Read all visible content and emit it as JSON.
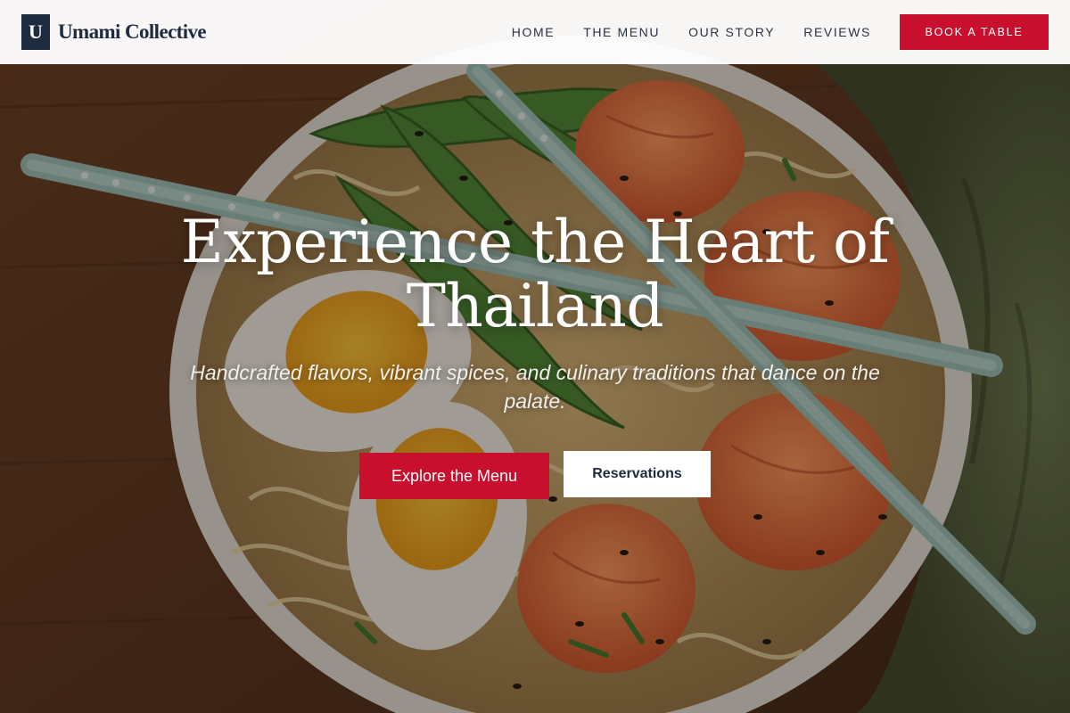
{
  "brand": {
    "mark": "U",
    "name": "Umami Collective"
  },
  "nav": {
    "items": [
      {
        "label": "HOME"
      },
      {
        "label": "THE MENU"
      },
      {
        "label": "OUR STORY"
      },
      {
        "label": "REVIEWS"
      }
    ],
    "cta_label": "BOOK A TABLE"
  },
  "hero": {
    "title": "Experience the Heart of Thailand",
    "subtitle": "Handcrafted flavors, vibrant spices, and culinary traditions that dance on the palate.",
    "primary_button": "Explore the Menu",
    "secondary_button": "Reservations"
  },
  "colors": {
    "accent": "#c8102e",
    "brand_navy": "#1e2a3e"
  }
}
